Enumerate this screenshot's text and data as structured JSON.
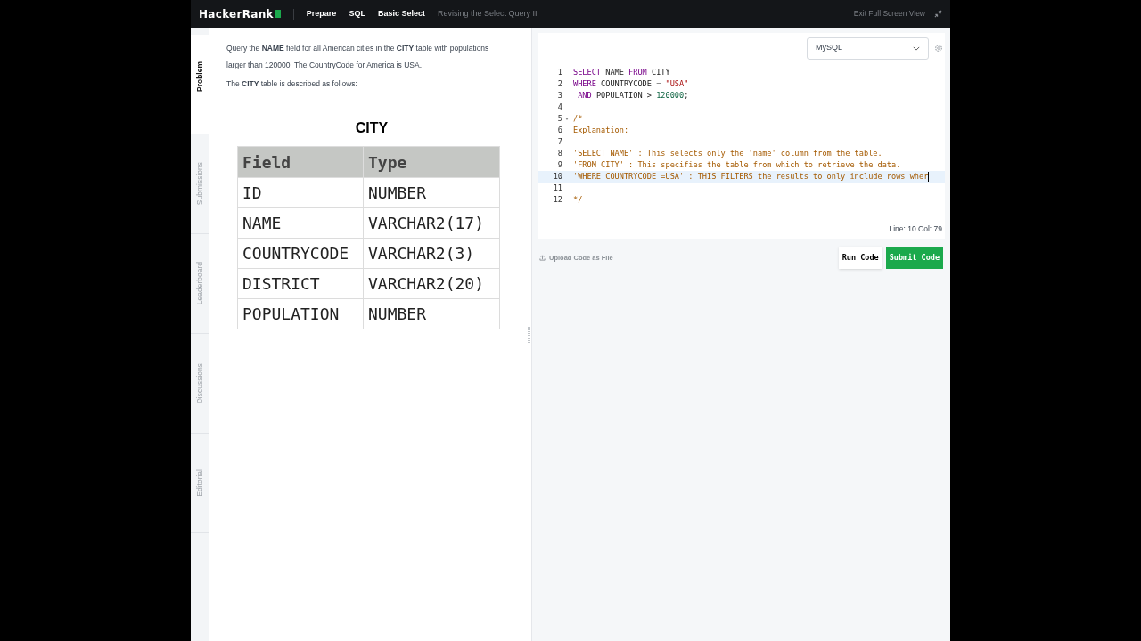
{
  "header": {
    "logo": "HackerRank",
    "breadcrumbs": [
      {
        "label": "Prepare",
        "current": false
      },
      {
        "label": "SQL",
        "current": false
      },
      {
        "label": "Basic Select",
        "current": false
      },
      {
        "label": "Revising the Select Query II",
        "current": true
      }
    ],
    "exit_label": "Exit Full Screen View"
  },
  "side_tabs": [
    {
      "label": "Problem",
      "selected": true
    },
    {
      "label": "Submissions",
      "selected": false
    },
    {
      "label": "Leaderboard",
      "selected": false
    },
    {
      "label": "Discussions",
      "selected": false
    },
    {
      "label": "Editorial",
      "selected": false
    }
  ],
  "problem": {
    "paragraphs": [
      "Query the **NAME** field for all American cities in the **CITY** table with populations larger than 120000. The CountryCode for America is USA.",
      "The **CITY** table is described as follows:"
    ],
    "table_title": "CITY",
    "columns": [
      "Field",
      "Type"
    ],
    "rows": [
      [
        "ID",
        "NUMBER"
      ],
      [
        "NAME",
        "VARCHAR2(17)"
      ],
      [
        "COUNTRYCODE",
        "VARCHAR2(3)"
      ],
      [
        "DISTRICT",
        "VARCHAR2(20)"
      ],
      [
        "POPULATION",
        "NUMBER"
      ]
    ]
  },
  "editor": {
    "language": "MySQL",
    "lines": [
      {
        "number": "1",
        "active": false,
        "tokens": [
          {
            "kind": "keyword",
            "text": "SELECT"
          },
          {
            "kind": "plain",
            "text": " NAME "
          },
          {
            "kind": "keyword",
            "text": "FROM"
          },
          {
            "kind": "plain",
            "text": " CITY"
          }
        ]
      },
      {
        "number": "2",
        "active": false,
        "tokens": [
          {
            "kind": "keyword",
            "text": "WHERE"
          },
          {
            "kind": "plain",
            "text": " COUNTRYCODE = "
          },
          {
            "kind": "string",
            "text": "\"USA\""
          }
        ]
      },
      {
        "number": "3",
        "active": false,
        "tokens": [
          {
            "kind": "keyword",
            "text": " AND"
          },
          {
            "kind": "plain",
            "text": " POPULATION > "
          },
          {
            "kind": "number",
            "text": "120000"
          },
          {
            "kind": "plain",
            "text": ";"
          }
        ]
      },
      {
        "number": "4",
        "active": false
      },
      {
        "number": "5",
        "active": false,
        "fold": true,
        "tokens": [
          {
            "kind": "comment",
            "text": "/*"
          }
        ]
      },
      {
        "number": "6",
        "active": false,
        "tokens": [
          {
            "kind": "comment",
            "text": "Explanation:"
          }
        ]
      },
      {
        "number": "7",
        "active": false
      },
      {
        "number": "8",
        "active": false,
        "tokens": [
          {
            "kind": "comment",
            "text": "'SELECT NAME' : This selects only the 'name' column from the table."
          }
        ]
      },
      {
        "number": "9",
        "active": false,
        "tokens": [
          {
            "kind": "comment",
            "text": "'FROM CITY' : This specifies the table from which to retrieve the data."
          }
        ]
      },
      {
        "number": "10",
        "active": true,
        "tokens": [
          {
            "kind": "comment",
            "text": "'WHERE COUNTRYCODE =USA' : THIS FILTERS the results to only include rows wher"
          }
        ]
      },
      {
        "number": "11",
        "active": false
      },
      {
        "number": "12",
        "active": false,
        "tokens": [
          {
            "kind": "comment",
            "text": "*/"
          }
        ]
      }
    ],
    "cursor_position": "Line: 10 Col: 79"
  },
  "footer": {
    "upload_label": "Upload Code as File",
    "run_button": "Run Code",
    "submit_button": "Submit Code"
  }
}
